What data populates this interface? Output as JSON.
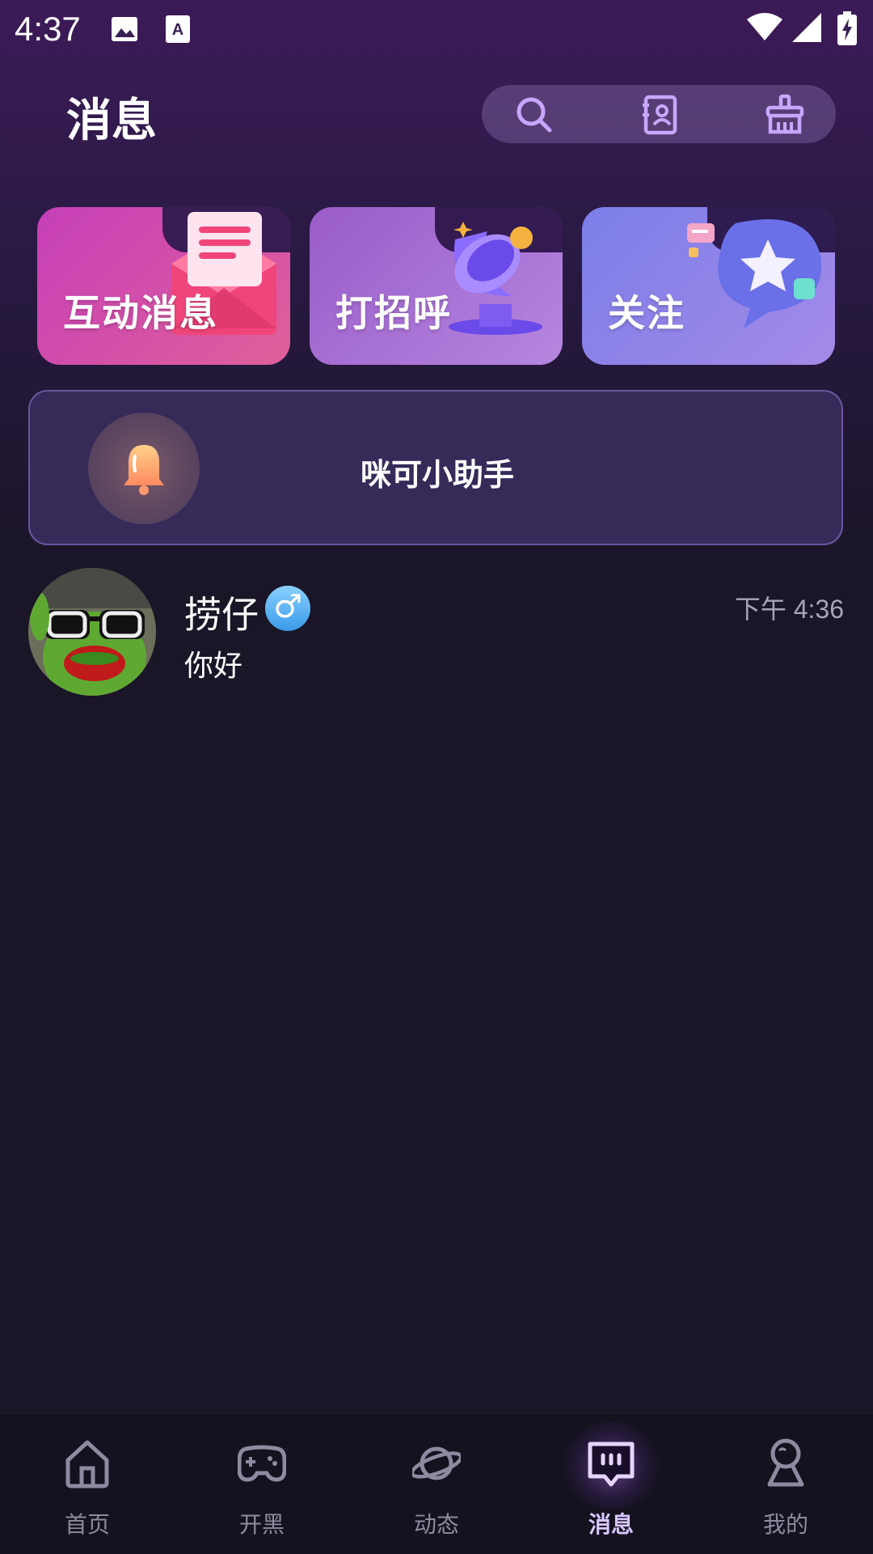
{
  "status_bar": {
    "time": "4:37",
    "icons": [
      "image-icon",
      "text-a-icon",
      "wifi-icon",
      "signal-icon",
      "battery-charging-icon"
    ]
  },
  "header": {
    "title": "消息",
    "actions": [
      "search-icon",
      "contacts-icon",
      "clear-broom-icon"
    ]
  },
  "cards": [
    {
      "label": "互动消息",
      "color_start": "#c53fb8",
      "color_end": "#e0609a"
    },
    {
      "label": "打招呼",
      "color_start": "#9a5cc8",
      "color_end": "#b586e0"
    },
    {
      "label": "关注",
      "color_start": "#7b7ee8",
      "color_end": "#a58ae8"
    }
  ],
  "assistant": {
    "name": "咪可小助手",
    "icon": "bell-icon"
  },
  "chats": [
    {
      "name": "捞仔",
      "gender_symbol": "♂",
      "time": "下午 4:36",
      "preview": "你好",
      "avatar": "frog-avatar"
    }
  ],
  "bottom_nav": {
    "items": [
      {
        "label": "首页",
        "icon": "home-icon",
        "active": false
      },
      {
        "label": "开黑",
        "icon": "gamepad-icon",
        "active": false
      },
      {
        "label": "动态",
        "icon": "planet-icon",
        "active": false
      },
      {
        "label": "消息",
        "icon": "message-icon",
        "active": true
      },
      {
        "label": "我的",
        "icon": "profile-icon",
        "active": false
      }
    ],
    "active_color": "#d9c6ff",
    "inactive_color": "#8e8aa0"
  }
}
